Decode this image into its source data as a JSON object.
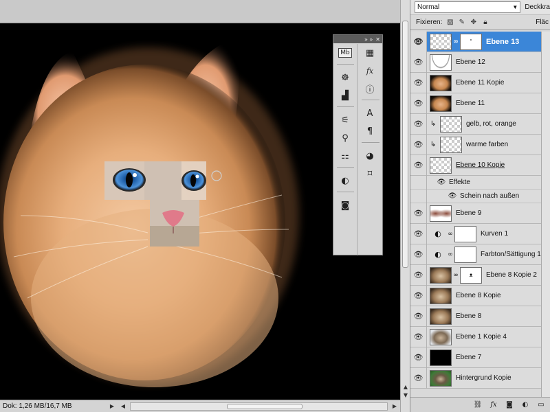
{
  "status": {
    "doc_info": "Dok: 1,26 MB/16,7 MB"
  },
  "tool_panel": {
    "title_arrows": "»  »",
    "close_glyph": "✕",
    "left_icons": [
      "mini-bridge-icon",
      "navigator-icon",
      "histogram-icon",
      "clone-source-icon",
      "brush-presets-icon",
      "tool-presets-icon",
      "adjustments-icon",
      "masks-icon"
    ],
    "right_icons": [
      "swatches-icon",
      "styles-icon",
      "info-icon",
      "character-icon",
      "paragraph-icon",
      "color-icon",
      "paths-icon"
    ],
    "mb_label": "Mb"
  },
  "layers_panel": {
    "blend_mode": "Normal",
    "opacity_label": "Deckkra",
    "lock_label": "Fixieren:",
    "fill_label": "Fläc",
    "effects_label": "Effekte",
    "effect_outer_glow": "Schein nach außen",
    "layers": [
      {
        "name": "Ebene 13",
        "selected": true,
        "thumb": "checker",
        "mask": "white",
        "mask_mark": "'"
      },
      {
        "name": "Ebene 12",
        "thumb": "arc"
      },
      {
        "name": "Ebene 11 Kopie",
        "thumb": "cat"
      },
      {
        "name": "Ebene 11",
        "thumb": "cat"
      },
      {
        "name": "gelb, rot, orange",
        "thumb": "checker",
        "clipped": true
      },
      {
        "name": "warme farben",
        "thumb": "checker",
        "clipped": true
      },
      {
        "name": "Ebene 10 Kopie",
        "thumb": "checker",
        "underline": true
      },
      {
        "name": "Ebene 9",
        "thumb": "swirl"
      },
      {
        "name": "Kurven 1",
        "adjustment": true,
        "mask": "white"
      },
      {
        "name": "Farbton/Sättigung 1",
        "adjustment": true,
        "mask": "white"
      },
      {
        "name": "Ebene 8 Kopie 2",
        "thumb": "cat2",
        "mask": "white",
        "mask_mark": "ᴥ"
      },
      {
        "name": "Ebene 8 Kopie",
        "thumb": "cat2"
      },
      {
        "name": "Ebene 8",
        "thumb": "cat2"
      },
      {
        "name": "Ebene 1 Kopie 4",
        "thumb": "cat3"
      },
      {
        "name": "Ebene 7",
        "thumb": "black"
      },
      {
        "name": "Hintergrund Kopie",
        "thumb": "green"
      }
    ]
  },
  "colors": {
    "selection": "#3b86d8",
    "canvas_bg": "#000000",
    "fur": "#e9b58a"
  }
}
